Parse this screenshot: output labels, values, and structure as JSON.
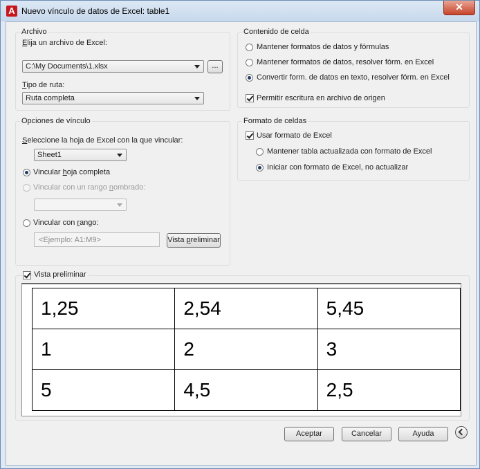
{
  "window": {
    "title": "Nuevo vínculo de datos de Excel: table1",
    "app_icon_letter": "A",
    "close_glyph": "✕"
  },
  "archivo": {
    "legend": "Archivo",
    "choose_label_pre": "",
    "choose_label_key": "E",
    "choose_label_post": "lija un archivo de Excel:",
    "file_value": "C:\\My Documents\\1.xlsx",
    "browse_label": "...",
    "path_type_label_pre": "",
    "path_type_label_key": "T",
    "path_type_label_post": "ipo de ruta:",
    "path_type_value": "Ruta completa"
  },
  "contenido": {
    "legend": "Contenido de celda",
    "opt1": "Mantener formatos de datos y fórmulas",
    "opt2": "Mantener formatos de datos, resolver fórm. en Excel",
    "opt3": "Convertir form. de datos en texto, resolver fórm. en Excel",
    "allow_write": "Permitir escritura en archivo de origen"
  },
  "opciones": {
    "legend": "Opciones de vínculo",
    "sheet_label_key": "S",
    "sheet_label_post": "eleccione la hoja de Excel con la que vincular:",
    "sheet_value": "Sheet1",
    "whole_pre": "Vincular ",
    "whole_key": "h",
    "whole_post": "oja completa",
    "named_pre": "Vincular con un rango ",
    "named_key": "n",
    "named_post": "ombrado:",
    "range_pre": "Vincular con ",
    "range_key": "r",
    "range_post": "ango:",
    "range_placeholder": "<Ejemplo: A1:M9>",
    "preview_btn_pre": "Vista ",
    "preview_btn_key": "p",
    "preview_btn_post": "reliminar"
  },
  "formato": {
    "legend": "Formato de celdas",
    "use_excel": "Usar formato de Excel",
    "keep_updated": "Mantener tabla actualizada con formato de Excel",
    "start_excel": "Iniciar con formato de Excel, no actualizar"
  },
  "preview": {
    "label": "Vista preliminar",
    "rows": [
      [
        "1,25",
        "2,54",
        "5,45"
      ],
      [
        "1",
        "2",
        "3"
      ],
      [
        "5",
        "4,5",
        "2,5"
      ]
    ]
  },
  "footer": {
    "accept": "Aceptar",
    "cancel": "Cancelar",
    "help": "Ayuda"
  }
}
